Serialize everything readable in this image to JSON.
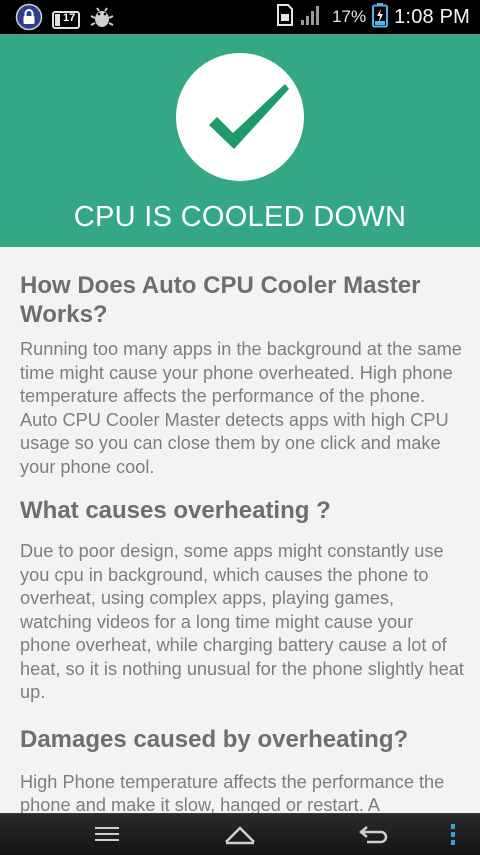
{
  "status_bar": {
    "battery_percent": "17%",
    "time": "1:08 PM",
    "notification_badge": "17",
    "icons": [
      "lock-icon",
      "calendar-icon",
      "android-debug-icon",
      "sim-icon",
      "signal-icon",
      "battery-charging-icon"
    ]
  },
  "header": {
    "title": "CPU IS COOLED DOWN",
    "icon": "checkmark-icon",
    "colors": {
      "background": "#34a885",
      "check": "#1f9a6b"
    }
  },
  "sections": [
    {
      "title": "How Does Auto CPU Cooler Master Works?",
      "body": "Running too many apps in the background at the same time might cause your phone overheated. High phone temperature affects the performance of the phone. Auto CPU Cooler Master detects apps with high CPU usage so you can close them by one click and make your phone cool."
    },
    {
      "title": "What causes overheating ?",
      "body": "Due to poor design, some apps might constantly use you cpu in background, which causes the phone to overheat, using complex apps, playing games, watching videos for a long time might cause your phone overheat, while charging battery cause a lot of heat, so it is nothing unusual for the phone slightly heat up."
    },
    {
      "title": "Damages caused by overheating?",
      "body": "High Phone temperature affects the performance the phone and make it slow, hanged or restart. A"
    }
  ],
  "nav_bar": {
    "buttons": [
      "menu-icon",
      "home-icon",
      "back-icon",
      "overflow-icon"
    ]
  }
}
